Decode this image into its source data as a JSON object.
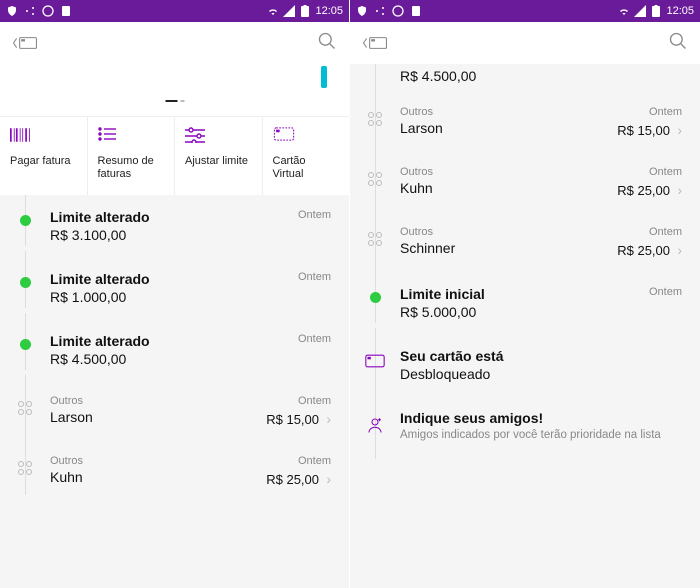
{
  "statusbar": {
    "time": "12:05"
  },
  "screen1": {
    "actions": [
      {
        "label": "Pagar fatura"
      },
      {
        "label": "Resumo de faturas"
      },
      {
        "label": "Ajustar limite"
      },
      {
        "label": "Cartão Virtual"
      }
    ],
    "feed": [
      {
        "kind": "limit",
        "title": "Limite alterado",
        "sub": "R$ 3.100,00",
        "time": "Ontem"
      },
      {
        "kind": "limit",
        "title": "Limite alterado",
        "sub": "R$ 1.000,00",
        "time": "Ontem"
      },
      {
        "kind": "limit",
        "title": "Limite alterado",
        "sub": "R$ 4.500,00",
        "time": "Ontem"
      },
      {
        "kind": "tx",
        "cat": "Outros",
        "title": "Larson",
        "amt": "R$ 15,00",
        "time": "Ontem"
      },
      {
        "kind": "tx",
        "cat": "Outros",
        "title": "Kuhn",
        "amt": "R$ 25,00",
        "time": "Ontem"
      }
    ]
  },
  "screen2": {
    "top_amount": "R$ 4.500,00",
    "feed": [
      {
        "kind": "tx",
        "cat": "Outros",
        "title": "Larson",
        "amt": "R$ 15,00",
        "time": "Ontem"
      },
      {
        "kind": "tx",
        "cat": "Outros",
        "title": "Kuhn",
        "amt": "R$ 25,00",
        "time": "Ontem"
      },
      {
        "kind": "tx",
        "cat": "Outros",
        "title": "Schinner",
        "amt": "R$ 25,00",
        "time": "Ontem"
      },
      {
        "kind": "limit",
        "title": "Limite inicial",
        "sub": "R$ 5.000,00",
        "time": "Ontem"
      },
      {
        "kind": "card",
        "title": "Seu cartão está",
        "sub": "Desbloqueado"
      },
      {
        "kind": "refer",
        "title": "Indique seus amigos!",
        "desc": "Amigos indicados por você terão prioridade na lista"
      }
    ]
  }
}
